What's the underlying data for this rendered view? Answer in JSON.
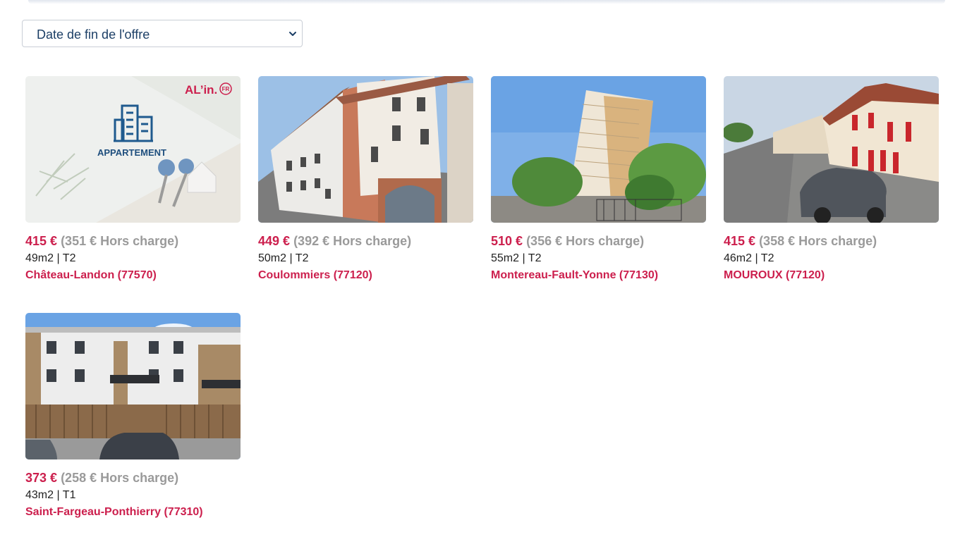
{
  "sort": {
    "selected": "Date de fin de l'offre"
  },
  "listings": [
    {
      "price": "415 €",
      "hors_charge": "(351 € Hors charge)",
      "surface": "49m2",
      "type": "T2",
      "city": "Château-Landon (77570)",
      "placeholder_label": "APPARTEMENT",
      "brand": "AL’in.",
      "brand_badge": "FR"
    },
    {
      "price": "449 €",
      "hors_charge": "(392 € Hors charge)",
      "surface": "50m2",
      "type": "T2",
      "city": "Coulommiers (77120)"
    },
    {
      "price": "510 €",
      "hors_charge": "(356 € Hors charge)",
      "surface": "55m2",
      "type": "T2",
      "city": "Montereau-Fault-Yonne (77130)"
    },
    {
      "price": "415 €",
      "hors_charge": "(358 € Hors charge)",
      "surface": "46m2",
      "type": "T2",
      "city": "MOUROUX (77120)"
    },
    {
      "price": "373 €",
      "hors_charge": "(258 € Hors charge)",
      "surface": "43m2",
      "type": "T1",
      "city": "Saint-Fargeau-Ponthierry (77310)"
    }
  ],
  "separator": "|",
  "colors": {
    "accent": "#cc1f4d",
    "muted": "#9a9a9a",
    "navy": "#1c3f66"
  },
  "icons": [
    "chevron-down-icon",
    "building-icon"
  ]
}
